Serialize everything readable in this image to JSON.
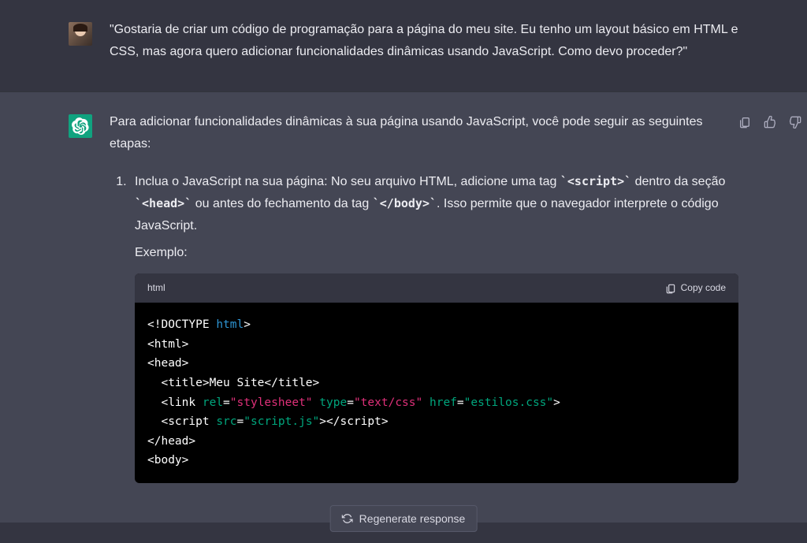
{
  "user_message": "\"Gostaria de criar um código de programação para a página do meu site. Eu tenho um layout básico em HTML e CSS, mas agora quero adicionar funcionalidades dinâmicas usando JavaScript. Como devo proceder?\"",
  "assistant": {
    "intro": "Para adicionar funcionalidades dinâmicas à sua página usando JavaScript, você pode seguir as seguintes etapas:",
    "step1": {
      "part1": "Inclua o JavaScript na sua página: No seu arquivo HTML, adicione uma tag ",
      "code1": "`<script>`",
      "part2": " dentro da seção ",
      "code2": "`<head>`",
      "part3": " ou antes do fechamento da tag ",
      "code3": "`</body>`",
      "part4": ". Isso permite que o navegador interprete o código JavaScript."
    },
    "example_label": "Exemplo:",
    "code_lang": "html",
    "copy_label": "Copy code",
    "code": {
      "l1a": "<!DOCTYPE ",
      "l1b": "html",
      "l1c": ">",
      "l2": "<html>",
      "l3": "<head>",
      "l4a": "  <title>",
      "l4b": "Meu Site",
      "l4c": "</title>",
      "l5a": "  <link ",
      "l5b": "rel",
      "l5c": "=",
      "l5d": "\"stylesheet\"",
      "l5e": " ",
      "l5f": "type",
      "l5g": "=",
      "l5h": "\"text/css\"",
      "l5i": " ",
      "l5j": "href",
      "l5k": "=",
      "l5l": "\"estilos.css\"",
      "l5m": ">",
      "l6a": "  <script ",
      "l6b": "src",
      "l6c": "=",
      "l6d": "\"script.js\"",
      "l6e": ">",
      "l6f": "</script>",
      "l7": "</head>",
      "l8": "<body>"
    }
  },
  "regenerate_label": "Regenerate response"
}
